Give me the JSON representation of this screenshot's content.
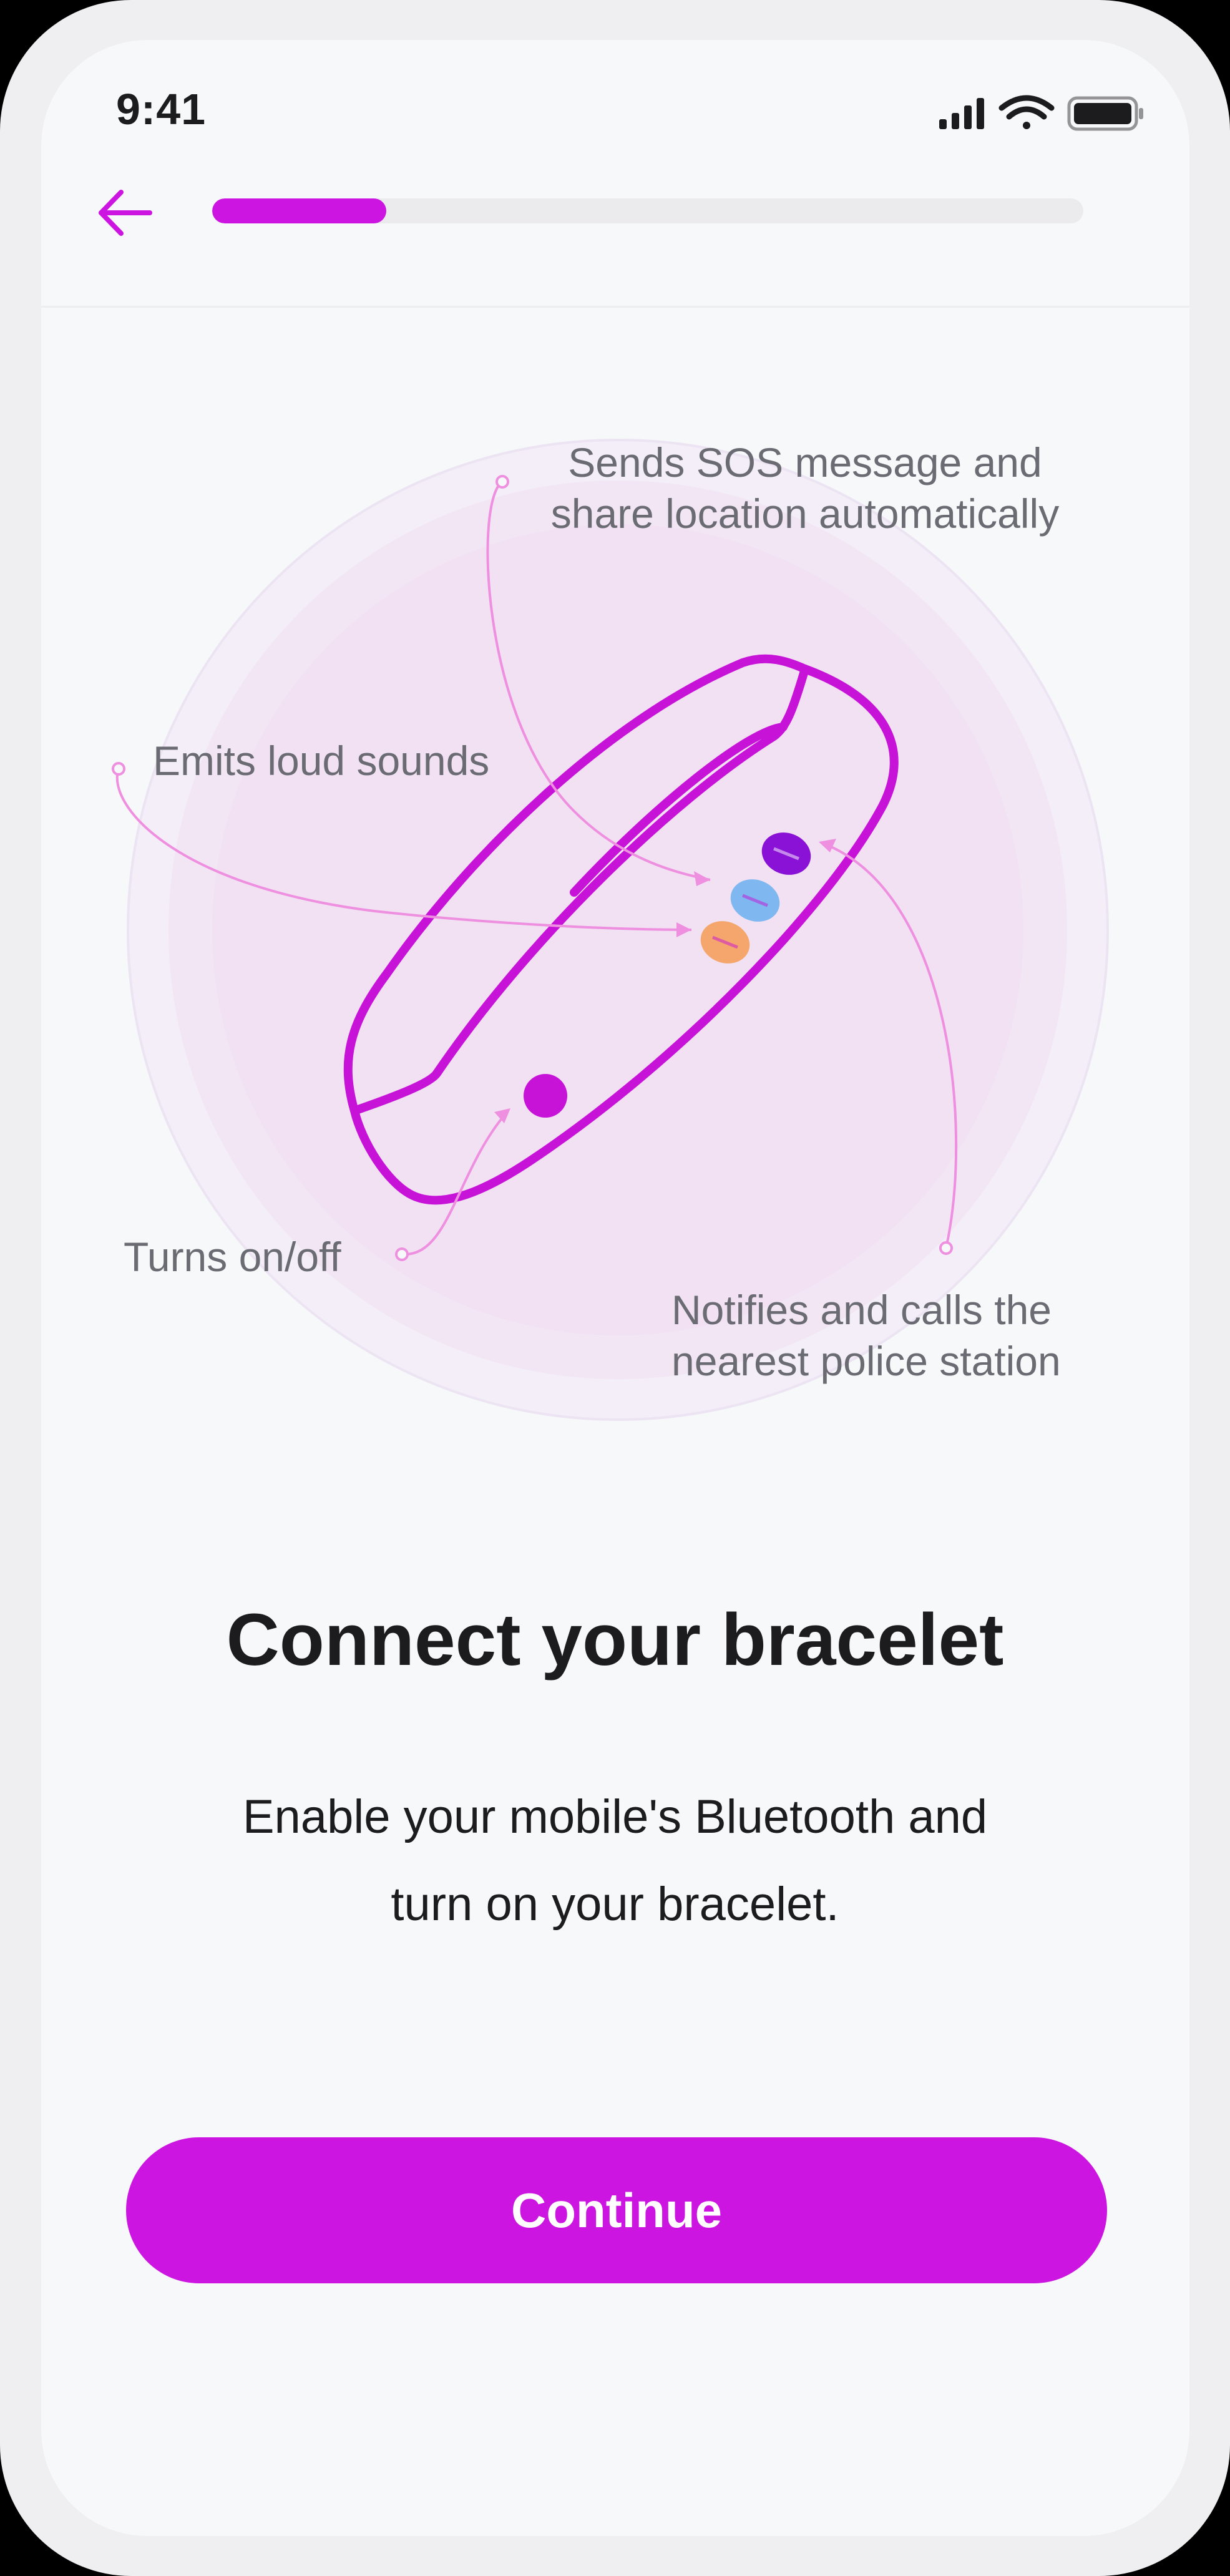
{
  "status_bar": {
    "time": "9:41",
    "icons": [
      "signal-icon",
      "wifi-icon",
      "battery-icon"
    ]
  },
  "nav": {
    "back_icon": "arrow-left-icon",
    "progress": 0.2
  },
  "illustration": {
    "callouts": {
      "sos_line1": "Sends SOS message and",
      "sos_line2": "share location automatically",
      "sound": "Emits loud sounds",
      "power": "Turns on/off",
      "police_line1": "Notifies and calls the",
      "police_line2": "nearest police station"
    }
  },
  "content": {
    "title": "Connect your bracelet",
    "subtitle_line1": "Enable your mobile's Bluetooth and",
    "subtitle_line2": "turn on your bracelet.",
    "continue_label": "Continue"
  },
  "colors": {
    "accent": "#cc15e0",
    "callout_line": "#ee8fe0",
    "button_sos": "#8a12d6",
    "button_police": "#7fb8f0",
    "button_sound": "#f5a66c"
  }
}
